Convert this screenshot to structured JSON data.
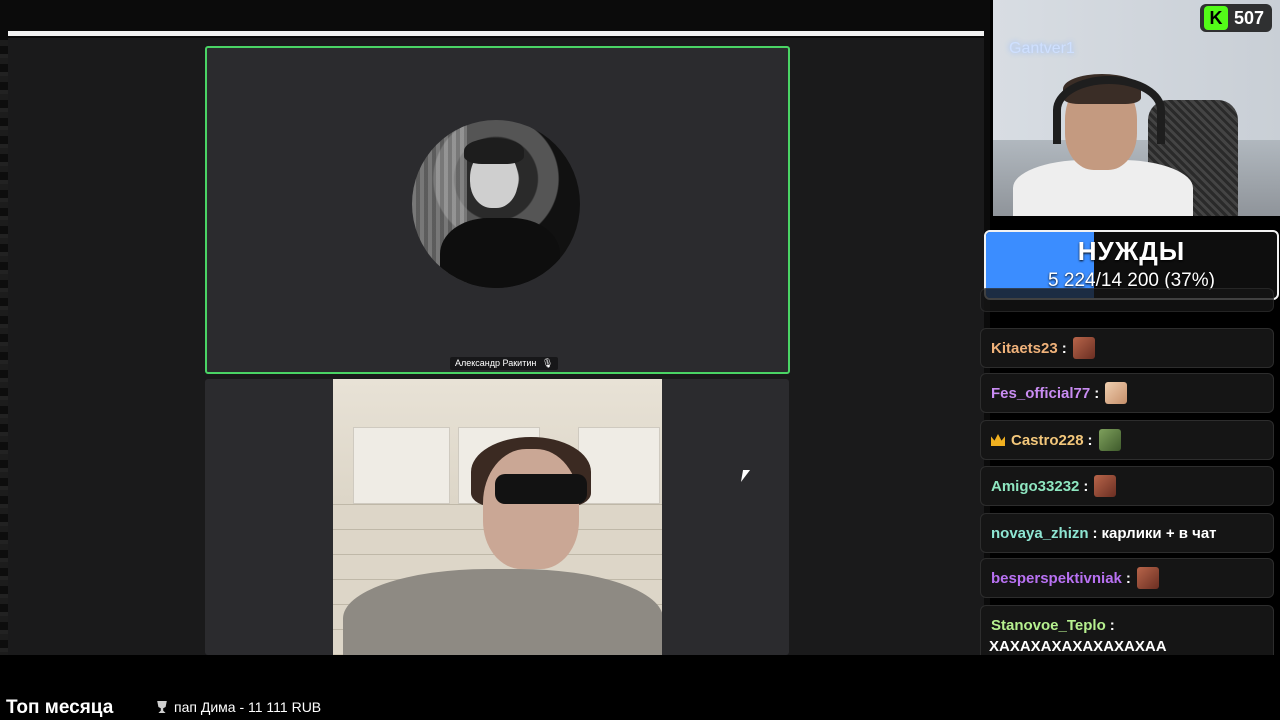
{
  "meeting": {
    "participant_top_name": "Александр Ракитин",
    "mic_icon": "mic-icon"
  },
  "overlay": {
    "webcam_neon_text": "Gantver1",
    "viewer_count": "507",
    "kick_icon": "kick-logo-icon"
  },
  "goal": {
    "title": "НУЖДЫ",
    "progress_text": "5 224/14 200 (37%)",
    "fill_fraction": 0.37,
    "fill_color": "#3b8dff"
  },
  "chat": {
    "messages": [
      {
        "user": "Kitaets23",
        "sep": ":",
        "text": "",
        "color": "#f0b27a",
        "emote": "emote"
      },
      {
        "user": "Fes_official77",
        "sep": ":",
        "text": "",
        "color": "#c98cf2",
        "emote": "emote"
      },
      {
        "user": "Castro228",
        "sep": ":",
        "text": "",
        "color": "#f3c77b",
        "emote": "emote",
        "badge": "crown-icon"
      },
      {
        "user": "Amigo33232",
        "sep": ":",
        "text": "",
        "color": "#8ee6c0",
        "emote": "emote"
      },
      {
        "user": "novaya_zhizn",
        "sep": ":",
        "text": "карлики + в чат",
        "color": "#8ee6d3"
      },
      {
        "user": "besperspektivniak",
        "sep": ":",
        "text": "",
        "color": "#b871f2",
        "emote": "emote"
      },
      {
        "user": "Stanovoe_Teplo",
        "sep": ":",
        "text": "ХАХАХАХАХАХАХАХАА",
        "color": "#b6f08f"
      }
    ]
  },
  "footer": {
    "top_month_label": "Топ месяца",
    "top_donor": "пап Дима - 11 111 RUB",
    "trophy_icon": "trophy-icon"
  }
}
